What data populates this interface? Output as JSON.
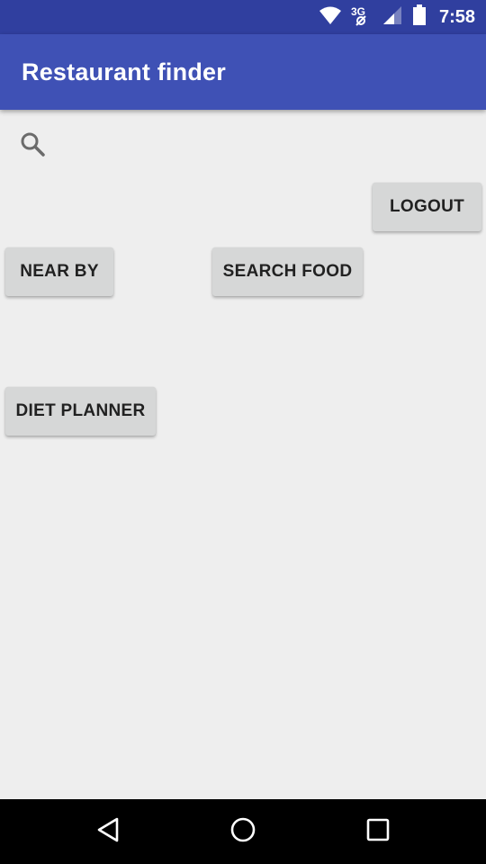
{
  "status_bar": {
    "time": "7:58",
    "network_label": "3G",
    "icons": [
      "wifi-icon",
      "network-3g-icon",
      "signal-icon",
      "battery-icon"
    ]
  },
  "app_bar": {
    "title": "Restaurant finder",
    "color": "#3f51b5",
    "status_color": "#303f9f"
  },
  "content": {
    "search_icon": "search-icon",
    "buttons": {
      "logout": "LOGOUT",
      "near_by": "NEAR BY",
      "search_food": "SEARCH FOOD",
      "diet_planner": "DIET PLANNER"
    }
  },
  "nav_bar": {
    "icons": [
      "back-icon",
      "home-icon",
      "recent-apps-icon"
    ]
  }
}
